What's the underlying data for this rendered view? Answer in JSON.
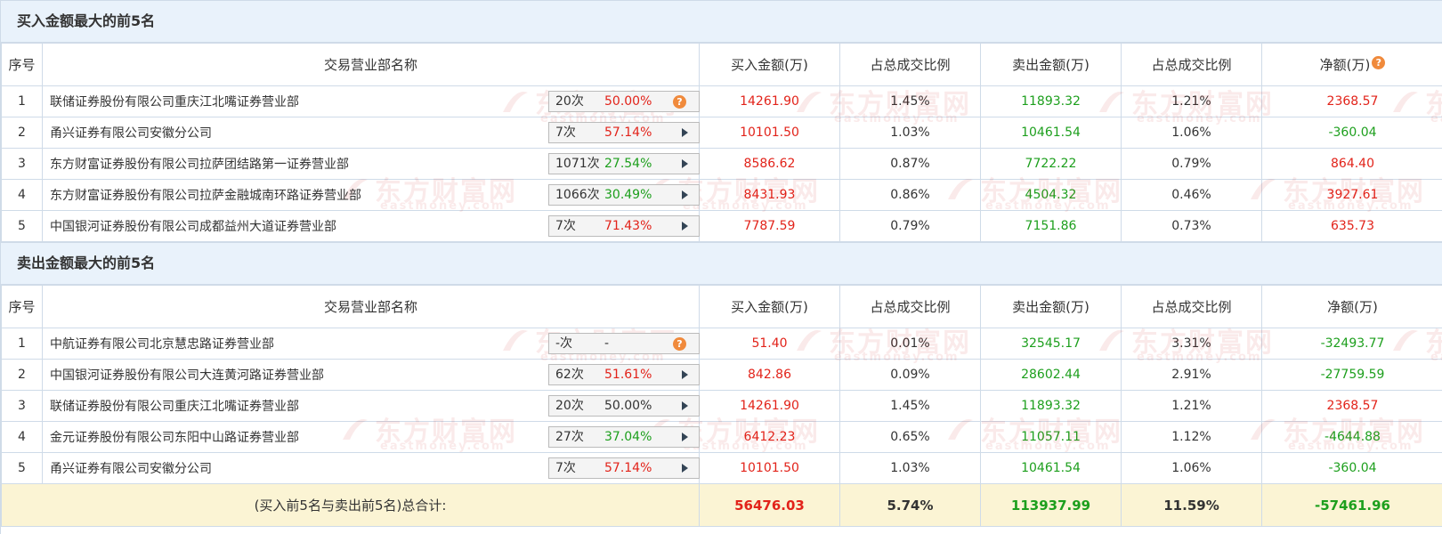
{
  "buy_section": {
    "title": "买入金额最大的前5名",
    "headers": [
      "序号",
      "交易营业部名称",
      "买入金额(万)",
      "占总成交比例",
      "卖出金额(万)",
      "占总成交比例",
      "净额(万)"
    ],
    "rows": [
      {
        "idx": "1",
        "name": "联储证券股份有限公司重庆江北嘴证券营业部",
        "count": "20次",
        "rate": "50.00%",
        "rate_color": "red",
        "indicator": "question",
        "buy": "14261.90",
        "buy_ratio": "1.45%",
        "sell": "11893.32",
        "sell_ratio": "1.21%",
        "net": "2368.57",
        "net_color": "red"
      },
      {
        "idx": "2",
        "name": "甬兴证券有限公司安徽分公司",
        "count": "7次",
        "rate": "57.14%",
        "rate_color": "red",
        "indicator": "arrow",
        "buy": "10101.50",
        "buy_ratio": "1.03%",
        "sell": "10461.54",
        "sell_ratio": "1.06%",
        "net": "-360.04",
        "net_color": "green"
      },
      {
        "idx": "3",
        "name": "东方财富证券股份有限公司拉萨团结路第一证券营业部",
        "count": "1071次",
        "rate": "27.54%",
        "rate_color": "green",
        "indicator": "arrow",
        "buy": "8586.62",
        "buy_ratio": "0.87%",
        "sell": "7722.22",
        "sell_ratio": "0.79%",
        "net": "864.40",
        "net_color": "red"
      },
      {
        "idx": "4",
        "name": "东方财富证券股份有限公司拉萨金融城南环路证券营业部",
        "count": "1066次",
        "rate": "30.49%",
        "rate_color": "green",
        "indicator": "arrow",
        "buy": "8431.93",
        "buy_ratio": "0.86%",
        "sell": "4504.32",
        "sell_ratio": "0.46%",
        "net": "3927.61",
        "net_color": "red"
      },
      {
        "idx": "5",
        "name": "中国银河证券股份有限公司成都益州大道证券营业部",
        "count": "7次",
        "rate": "71.43%",
        "rate_color": "red",
        "indicator": "arrow",
        "buy": "7787.59",
        "buy_ratio": "0.79%",
        "sell": "7151.86",
        "sell_ratio": "0.73%",
        "net": "635.73",
        "net_color": "red"
      }
    ]
  },
  "sell_section": {
    "title": "卖出金额最大的前5名",
    "headers": [
      "序号",
      "交易营业部名称",
      "买入金额(万)",
      "占总成交比例",
      "卖出金额(万)",
      "占总成交比例",
      "净额(万)"
    ],
    "rows": [
      {
        "idx": "1",
        "name": "中航证券有限公司北京慧忠路证券营业部",
        "count": "-次",
        "rate": "-",
        "rate_color": "black",
        "indicator": "question",
        "buy": "51.40",
        "buy_ratio": "0.01%",
        "sell": "32545.17",
        "sell_ratio": "3.31%",
        "net": "-32493.77",
        "net_color": "green"
      },
      {
        "idx": "2",
        "name": "中国银河证券股份有限公司大连黄河路证券营业部",
        "count": "62次",
        "rate": "51.61%",
        "rate_color": "red",
        "indicator": "arrow",
        "buy": "842.86",
        "buy_ratio": "0.09%",
        "sell": "28602.44",
        "sell_ratio": "2.91%",
        "net": "-27759.59",
        "net_color": "green"
      },
      {
        "idx": "3",
        "name": "联储证券股份有限公司重庆江北嘴证券营业部",
        "count": "20次",
        "rate": "50.00%",
        "rate_color": "black",
        "indicator": "arrow",
        "buy": "14261.90",
        "buy_ratio": "1.45%",
        "sell": "11893.32",
        "sell_ratio": "1.21%",
        "net": "2368.57",
        "net_color": "red"
      },
      {
        "idx": "4",
        "name": "金元证券股份有限公司东阳中山路证券营业部",
        "count": "27次",
        "rate": "37.04%",
        "rate_color": "green",
        "indicator": "arrow",
        "buy": "6412.23",
        "buy_ratio": "0.65%",
        "sell": "11057.11",
        "sell_ratio": "1.12%",
        "net": "-4644.88",
        "net_color": "green"
      },
      {
        "idx": "5",
        "name": "甬兴证券有限公司安徽分公司",
        "count": "7次",
        "rate": "57.14%",
        "rate_color": "red",
        "indicator": "arrow",
        "buy": "10101.50",
        "buy_ratio": "1.03%",
        "sell": "10461.54",
        "sell_ratio": "1.06%",
        "net": "-360.04",
        "net_color": "green"
      }
    ]
  },
  "total": {
    "label": "(买入前5名与卖出前5名)总合计:",
    "buy": "56476.03",
    "buy_ratio": "5.74%",
    "sell": "113937.99",
    "sell_ratio": "11.59%",
    "net": "-57461.96"
  },
  "watermark": {
    "cn": "东方财富网",
    "en": "eastmoney.com"
  },
  "colors": {
    "red": "#e2231a",
    "green": "#1d9f1d",
    "header_bg": "#e9f2fb",
    "total_bg": "#fbf4d4",
    "badge": "#f08a3c"
  }
}
